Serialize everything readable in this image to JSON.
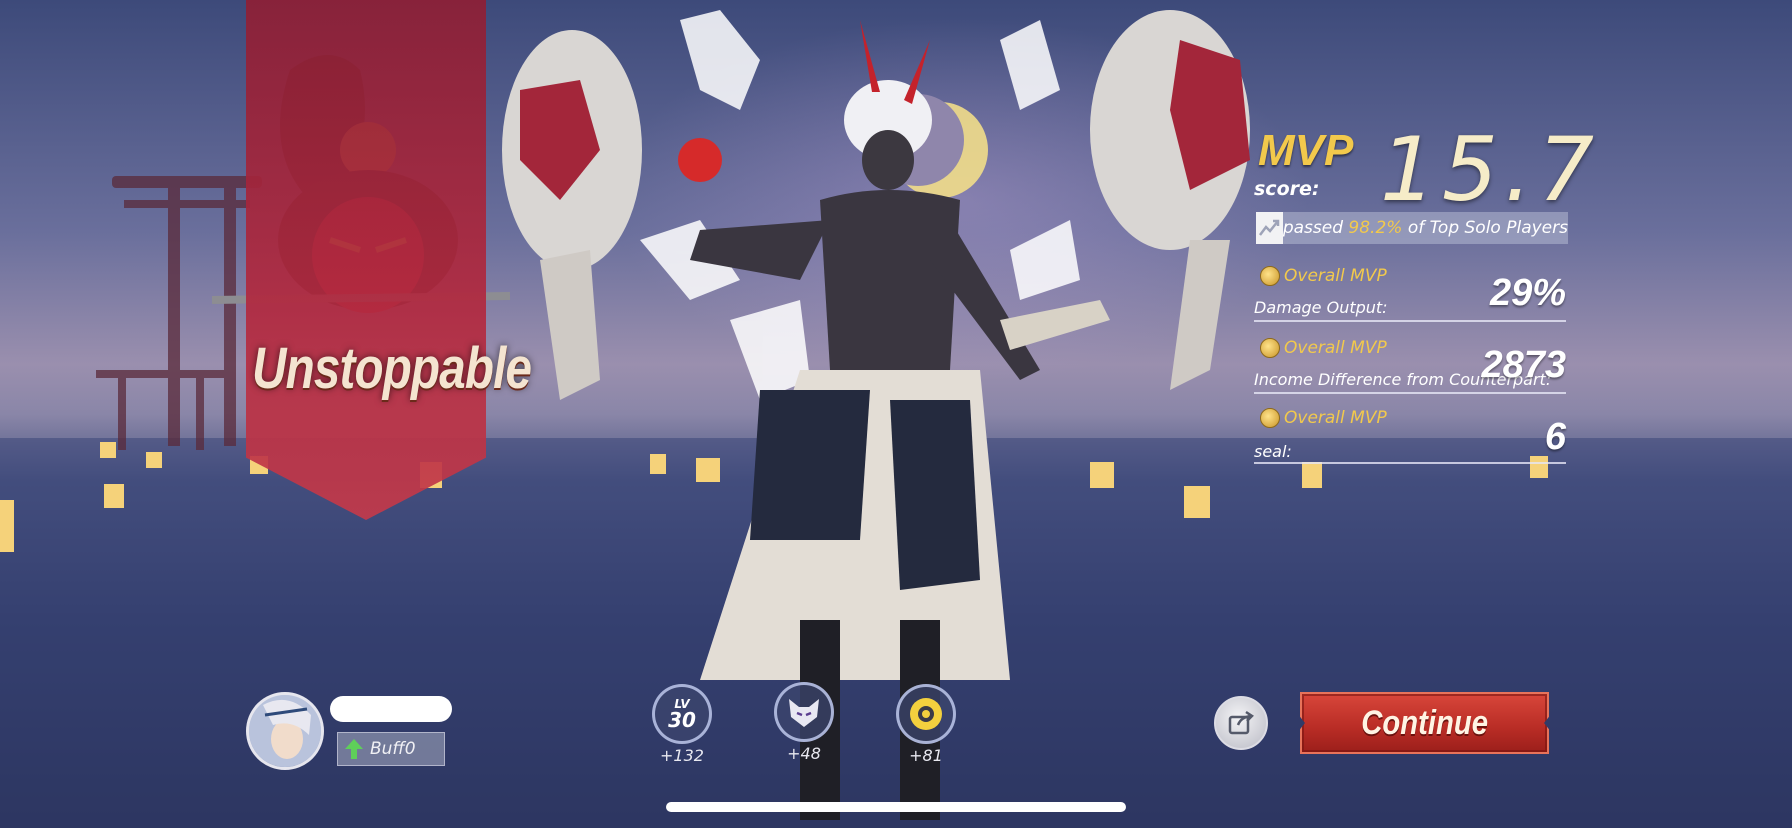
{
  "result": {
    "banner_title": "Unstoppable",
    "mvp_label": "MVP",
    "score_label": "score:",
    "score_value": "15.7",
    "surpass": {
      "prefix": "passed ",
      "percent": "98.2%",
      "suffix": " of Top Solo Players"
    }
  },
  "stats": [
    {
      "tag": "Overall MVP",
      "label": "Damage Output:",
      "value": "29%"
    },
    {
      "tag": "Overall MVP",
      "label": "Income Difference from Counterpart:",
      "value": "2873"
    },
    {
      "tag": "Overall MVP",
      "label": "seal:",
      "value": "6"
    }
  ],
  "player": {
    "buff_label": "Buff0"
  },
  "badges": [
    {
      "name": "level",
      "top": "LV",
      "bottom": "30",
      "value": "+132"
    },
    {
      "name": "fox-mask",
      "value": "+48"
    },
    {
      "name": "coin",
      "value": "+81"
    }
  ],
  "actions": {
    "continue_label": "Continue"
  },
  "colors": {
    "gold": "#f2c94c",
    "banner_red": "#b2293f",
    "continue_red": "#c0302a"
  },
  "icons": {
    "surpass": "trend-chart-icon",
    "tag": "gold-coin-icon",
    "buff": "green-up-arrow-icon",
    "share": "share-icon"
  }
}
